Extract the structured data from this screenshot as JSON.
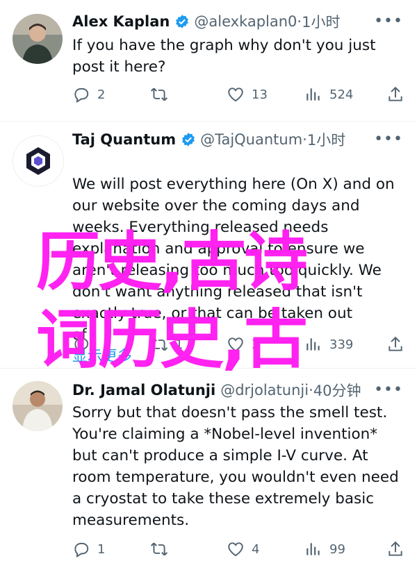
{
  "colors": {
    "accent": "#1d9bf0",
    "overlay": "#ff1ef0",
    "muted": "#536471"
  },
  "icons": [
    "verified-badge-icon",
    "more-icon",
    "reply-icon",
    "retweet-icon",
    "like-icon",
    "views-icon",
    "share-icon"
  ],
  "tweets": [
    {
      "name": "Alex Kaplan",
      "handle": "@alexkaplan0",
      "time": "1小时",
      "text": "If you have the graph why don't you just\npost it here?",
      "replies": "2",
      "retweets": "",
      "likes": "13",
      "views": "524"
    },
    {
      "name": "Taj Quantum",
      "handle": "@TajQuantum",
      "time": "1小时",
      "text": "We will post everything here (On X) and on\nour website over the coming days and\nweeks. Everything released needs\nexplanation and approval to ensure we\naren't releasing too much too quickly. We\ndon't want anything released that isn't\nexactly true, or that can be taken out\nof",
      "show_more": "显示更多",
      "replies": "",
      "retweets": "1",
      "likes": "3",
      "views": "339"
    },
    {
      "name": "Dr. Jamal Olatunji",
      "handle": "@drjolatunji",
      "time": "40分钟",
      "text": "Sorry but that doesn't pass the smell test.\nYou're claiming a *Nobel-level invention*\nbut can't produce a simple I-V curve. At\nroom temperature, you wouldn't even need\na cryostat to take these extremely basic\nmeasurements.",
      "replies": "1",
      "retweets": "",
      "likes": "4",
      "views": "99"
    }
  ],
  "overlay": {
    "line1": "历史,古诗",
    "line2": "词历史,古"
  }
}
